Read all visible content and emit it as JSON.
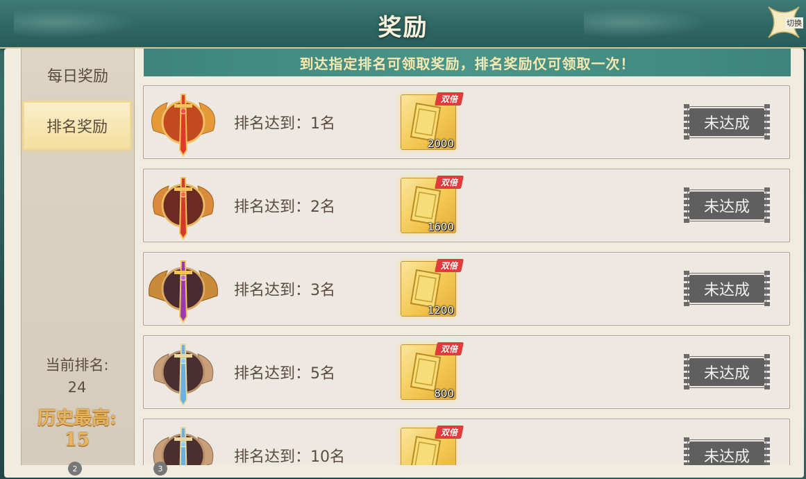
{
  "header": {
    "title": "奖励",
    "switch_label": "切换"
  },
  "sidebar": {
    "tabs": [
      {
        "label": "每日奖励",
        "active": false
      },
      {
        "label": "排名奖励",
        "active": true
      }
    ],
    "current_rank_label": "当前排名:",
    "current_rank": "24",
    "history_best_label": "历史最高:",
    "history_best": "15"
  },
  "banner": {
    "text": "到达指定排名可领取奖励，排名奖励仅可领取一次！"
  },
  "rows": [
    {
      "label": "排名达到：1名",
      "double_tag": "双倍",
      "amount": "2000",
      "status": "未达成",
      "badge": "crown-sword-gold-icon"
    },
    {
      "label": "排名达到：2名",
      "double_tag": "双倍",
      "amount": "1600",
      "status": "未达成",
      "badge": "crown-sword-red-icon"
    },
    {
      "label": "排名达到：3名",
      "double_tag": "双倍",
      "amount": "1200",
      "status": "未达成",
      "badge": "crown-sword-purple-icon"
    },
    {
      "label": "排名达到：5名",
      "double_tag": "双倍",
      "amount": "800",
      "status": "未达成",
      "badge": "crown-sword-blue-icon"
    },
    {
      "label": "排名达到：10名",
      "double_tag": "双倍",
      "amount": "",
      "status": "未达成",
      "badge": "crown-sword-blue-icon"
    }
  ],
  "pagination": {
    "dots": [
      "2",
      "3"
    ]
  },
  "colors": {
    "header_bg": "#2f6763",
    "banner_bg": "#4b958a",
    "banner_text": "#f7e9b0",
    "status_button": "#5f5f5f",
    "double_tag": "#e13b3b",
    "history_best": "#e9b45c"
  }
}
